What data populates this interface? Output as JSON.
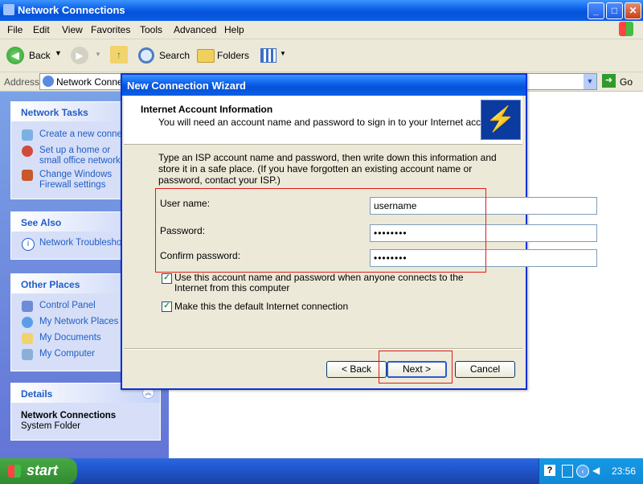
{
  "window": {
    "title": "Network Connections"
  },
  "menu": [
    "File",
    "Edit",
    "View",
    "Favorites",
    "Tools",
    "Advanced",
    "Help"
  ],
  "toolbar": {
    "back": "Back",
    "search": "Search",
    "folders": "Folders"
  },
  "address": {
    "label": "Address",
    "value": "Network Connections",
    "go": "Go"
  },
  "sidebar": {
    "network_tasks": {
      "title": "Network Tasks",
      "items": [
        "Create a new connection",
        "Set up a home or small office network",
        "Change Windows Firewall settings"
      ]
    },
    "see_also": {
      "title": "See Also",
      "items": [
        "Network Troubleshooter"
      ]
    },
    "other_places": {
      "title": "Other Places",
      "items": [
        "Control Panel",
        "My Network Places",
        "My Documents",
        "My Computer"
      ]
    },
    "details": {
      "title": "Details",
      "name": "Network Connections",
      "type": "System Folder"
    }
  },
  "wizard": {
    "title": "New Connection Wizard",
    "heading": "Internet Account Information",
    "subheading": "You will need an account name and password to sign in to your Internet account.",
    "instructions": "Type an ISP account name and password, then write down this information and store it in a safe place. (If you have forgotten an existing account name or password, contact your ISP.)",
    "username_label": "User name:",
    "username_value": "username",
    "password_label": "Password:",
    "password_value": "••••••••",
    "confirm_label": "Confirm password:",
    "confirm_value": "••••••••",
    "check1_label": "Use this account  name and password when anyone connects to the Internet from this computer",
    "check1_checked": true,
    "check2_label": "Make this the default Internet connection",
    "check2_checked": true,
    "back_button": "< Back",
    "next_button": "Next >",
    "cancel_button": "Cancel"
  },
  "taskbar": {
    "start": "start",
    "clock": "23:56"
  }
}
